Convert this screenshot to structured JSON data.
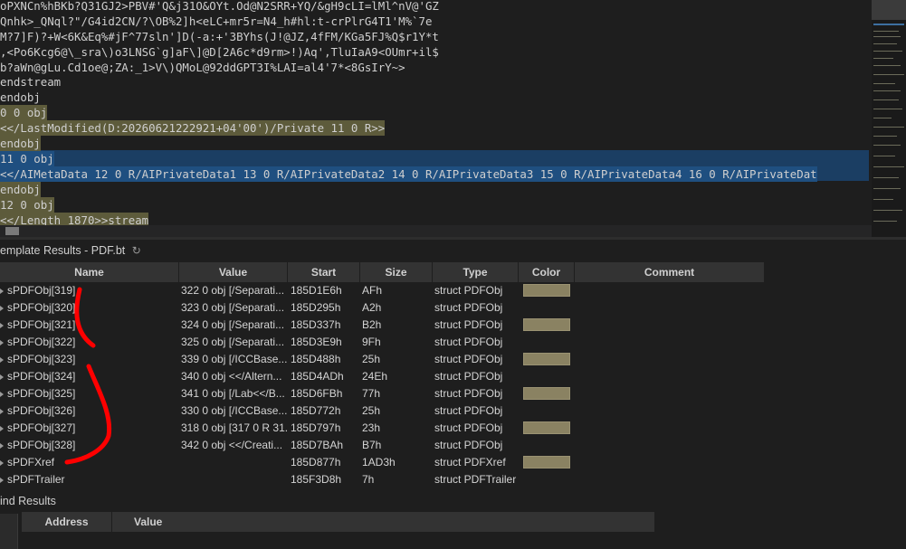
{
  "editor": {
    "lines": [
      "oPXNCn%hBKb?Q31GJ2>PBV#'Q&j31O&OYt.Od@N2SRR+YQ/&gH9cLI=lMl^nV@'GZ",
      "Qnhk>_QNql?\"/G4id2CN/?\\OB%2]h<eLC+mr5r=N4_h#hl:t-crPlrG4T1'M%`7e",
      "M?7]F)?+W<6K&Eq%#jF^77sln']D(-a:+'3BYhs(J!@JZ,4fFM/KGa5FJ%Q$r1Y*t",
      ",<Po6Kcg6@\\_sra\\)o3LNSG`g]aF\\]@D[2A6c*d9rm>!)Aq',TluIaA9<OUmr+il$",
      "b?aWn@gLu.Cd1oe@;ZA:_1>V\\)QMoL@92ddGPT3I%LAI=al4'7*<8GsIrY~>",
      "endstream",
      "endobj",
      "0 0 obj",
      "<</LastModified(D:20260621222921+04'00')/Private 11 0 R>>",
      "endobj",
      "11 0 obj",
      "<</AIMetaData 12 0 R/AIPrivateData1 13 0 R/AIPrivateData2 14 0 R/AIPrivateData3 15 0 R/AIPrivateData4 16 0 R/AIPrivateDat",
      "endobj",
      "12 0 obj",
      "<</Length 1870>>stream"
    ]
  },
  "template_results": {
    "title": "emplate Results - PDF.bt",
    "refresh_icon": "refresh-icon",
    "columns": [
      "Name",
      "Value",
      "Start",
      "Size",
      "Type",
      "Color",
      "Comment"
    ],
    "rows": [
      {
        "name": "sPDFObj[319]",
        "value": "322 0 obj  [/Separati...",
        "start": "185D1E6h",
        "size": "AFh",
        "type": "struct PDFObj",
        "color": true
      },
      {
        "name": "sPDFObj[320]",
        "value": "323 0 obj  [/Separati...",
        "start": "185D295h",
        "size": "A2h",
        "type": "struct PDFObj",
        "color": false
      },
      {
        "name": "sPDFObj[321]",
        "value": "324 0 obj  [/Separati...",
        "start": "185D337h",
        "size": "B2h",
        "type": "struct PDFObj",
        "color": true
      },
      {
        "name": "sPDFObj[322]",
        "value": "325 0 obj  [/Separati...",
        "start": "185D3E9h",
        "size": "9Fh",
        "type": "struct PDFObj",
        "color": false
      },
      {
        "name": "sPDFObj[323]",
        "value": "339 0 obj  [/ICCBase...",
        "start": "185D488h",
        "size": "25h",
        "type": "struct PDFObj",
        "color": true
      },
      {
        "name": "sPDFObj[324]",
        "value": "340 0 obj  <</Altern...",
        "start": "185D4ADh",
        "size": "24Eh",
        "type": "struct PDFObj",
        "color": false
      },
      {
        "name": "sPDFObj[325]",
        "value": "341 0 obj  [/Lab<</B...",
        "start": "185D6FBh",
        "size": "77h",
        "type": "struct PDFObj",
        "color": true
      },
      {
        "name": "sPDFObj[326]",
        "value": "330 0 obj  [/ICCBase...",
        "start": "185D772h",
        "size": "25h",
        "type": "struct PDFObj",
        "color": false
      },
      {
        "name": "sPDFObj[327]",
        "value": "318 0 obj  [317 0 R 31...",
        "start": "185D797h",
        "size": "23h",
        "type": "struct PDFObj",
        "color": true
      },
      {
        "name": "sPDFObj[328]",
        "value": "342 0 obj  <</Creati...",
        "start": "185D7BAh",
        "size": "B7h",
        "type": "struct PDFObj",
        "color": false
      },
      {
        "name": "sPDFXref",
        "value": "",
        "start": "185D877h",
        "size": "1AD3h",
        "type": "struct PDFXref",
        "color": true
      },
      {
        "name": "sPDFTrailer",
        "value": "",
        "start": "185F3D8h",
        "size": "7h",
        "type": "struct PDFTrailer",
        "color": false
      }
    ]
  },
  "find_results": {
    "title": "ind Results",
    "columns": [
      "Address",
      "Value"
    ]
  },
  "colors": {
    "background": "#1e1e1e",
    "selection_blue": "#1f4f80",
    "highlight_olive": "#5d5b3b",
    "swatch": "#8a8262",
    "annotation_red": "#ff0000"
  }
}
